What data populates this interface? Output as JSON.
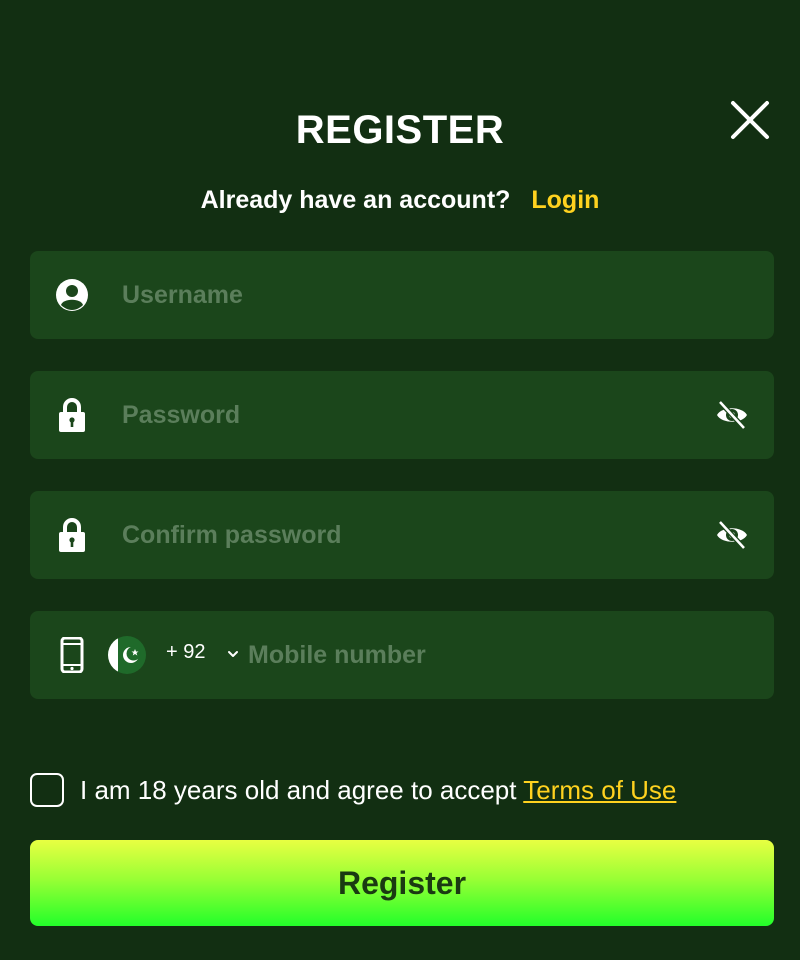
{
  "modal": {
    "title": "REGISTER",
    "subtitle": "Already have an account?",
    "login_link": "Login"
  },
  "fields": {
    "username": {
      "placeholder": "Username",
      "icon": "user-circle-icon"
    },
    "password": {
      "placeholder": "Password",
      "icon": "lock-icon",
      "toggle_icon": "eye-off-icon"
    },
    "confirm_password": {
      "placeholder": "Confirm password",
      "icon": "lock-icon",
      "toggle_icon": "eye-off-icon"
    },
    "mobile": {
      "placeholder": "Mobile number",
      "icon": "mobile-phone-icon",
      "country_flag": "pakistan-flag-icon",
      "country_code": "+ 92"
    }
  },
  "terms": {
    "text": "I am 18 years old and agree to accept ",
    "link": "Terms of Use",
    "checked": false
  },
  "actions": {
    "register_label": "Register"
  },
  "colors": {
    "background": "#122f12",
    "field": "#1b461b",
    "accent_link": "#ffd21f",
    "button_top": "#e8ff42",
    "button_bottom": "#22ff2a"
  }
}
